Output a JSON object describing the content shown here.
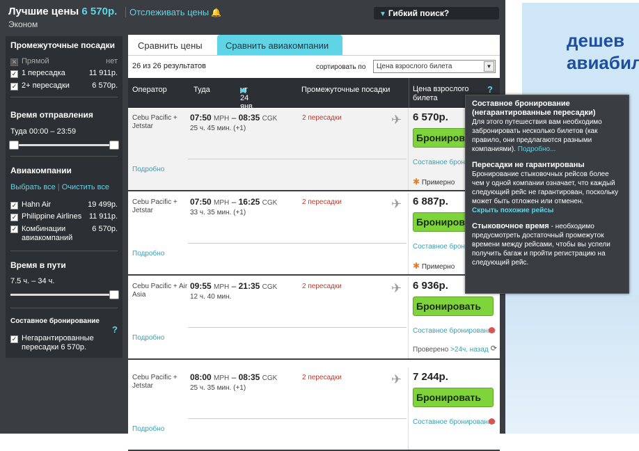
{
  "header": {
    "best_label": "Лучшие цены",
    "best_price": "6 570р.",
    "class": "Эконом",
    "track_link": "Отслеживать цены",
    "flex_search": "Гибкий поиск?"
  },
  "sidebar": {
    "stops_title": "Промежуточные посадки",
    "stops": [
      {
        "label": "Прямой",
        "value": "нет",
        "checked": false,
        "disabled": true
      },
      {
        "label": "1 пересадка",
        "value": "11 911р.",
        "checked": true
      },
      {
        "label": "2+ пересадки",
        "value": "6 570р.",
        "checked": true
      }
    ],
    "departure_title": "Время отправления",
    "departure_range": "Туда 00:00 – 23:59",
    "airlines_title": "Авиакомпании",
    "select_all": "Выбрать все",
    "clear_all": "Очистить все",
    "airlines": [
      {
        "label": "Hahn Air",
        "value": "19 499р."
      },
      {
        "label": "Philippine Airlines",
        "value": "11 911р."
      },
      {
        "label": "Комбинации авиакомпаний",
        "value": "6 570р."
      }
    ],
    "duration_title": "Время в пути",
    "duration_range": "7.5 ч. – 34 ч.",
    "combo_title": "Составное бронирование",
    "combo_help": "?",
    "combo_option": "Негарантированные пересадки 6 570р."
  },
  "tabs": {
    "compare_prices": "Сравнить цены",
    "compare_airlines": "Сравнить авиакомпании"
  },
  "results": {
    "count": "26 из 26 результатов",
    "sort_label": "сортировать по",
    "sort_value": "Цена взрослого билета"
  },
  "columns": {
    "operator": "Оператор",
    "outbound": "Туда",
    "date": "чт 24 янв",
    "stops": "Промежуточные посадки",
    "price": "Цена взрослого билета",
    "help": "?"
  },
  "flights": [
    {
      "operator": "Cebu Pacific + Jetstar",
      "dep": "07:50",
      "dep_code": "MPH",
      "arr": "08:35",
      "arr_code": "CGK",
      "duration": "25 ч. 45 мин. (+1)",
      "stops": "2 пересадки",
      "price": "6 570р.",
      "book": "Бронировать",
      "details": "Подробно",
      "combo": "Составное бронирование",
      "note": "Примерно"
    },
    {
      "operator": "Cebu Pacific + Jetstar",
      "dep": "07:50",
      "dep_code": "MPH",
      "arr": "16:25",
      "arr_code": "CGK",
      "duration": "33 ч. 35 мин. (+1)",
      "stops": "2 пересадки",
      "price": "6 887р.",
      "book": "Бронировать",
      "details": "Подробно",
      "combo": "Составное бронирование",
      "note": "Примерно"
    },
    {
      "operator": "Cebu Pacific + Air Asia",
      "dep": "09:55",
      "dep_code": "MPH",
      "arr": "21:35",
      "arr_code": "CGK",
      "duration": "12 ч. 40 мин.",
      "stops": "2 пересадки",
      "price": "6 936р.",
      "book": "Бронировать",
      "details": "Подробно",
      "combo": "Составное бронирование",
      "verified": "Проверено",
      "verified_link": ">24ч. назад"
    },
    {
      "operator": "Cebu Pacific + Jetstar",
      "dep": "08:00",
      "dep_code": "MPH",
      "arr": "08:35",
      "arr_code": "CGK",
      "duration": "25 ч. 35 мин. (+1)",
      "stops": "2 пересадки",
      "price": "7 244р.",
      "book": "Бронировать",
      "details": "Подробно",
      "combo": "Составное бронирование"
    }
  ],
  "tooltip": {
    "t1": "Составное бронирование (негарантированные пересадки)",
    "b1": "Для этого путешествия вам необходимо забронировать несколько билетов (как правило, они предлагаются разными компаниями).",
    "l1": "Подробно...",
    "t2": "Пересадки не гарантированы",
    "b2": "Бронирование стыковочных рейсов более чем у одной компании означает, что каждый следующий рейс не гарантирован, поскольку может быть отложен или отменен.",
    "l2": "Скрыть похожие рейсы",
    "t3": "Стыковочное время",
    "b3": "- необходимо предусмотреть достаточный промежуток времени между рейсами, чтобы вы успели получить багаж и пройти регистрацию на следующий рейс."
  },
  "ad": {
    "line1": "дешев",
    "line2": "авиабил"
  },
  "colors": {
    "accent": "#5fd4e6",
    "book": "#7fd43c",
    "stops": "#c0392b",
    "dark": "#3a3d42"
  }
}
